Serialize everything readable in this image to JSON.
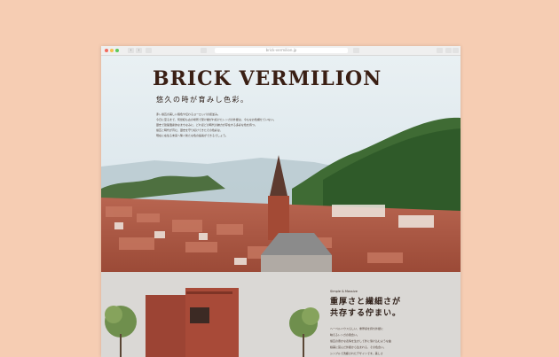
{
  "browser": {
    "url": "brick-vermilion.jp",
    "back_icon": "‹",
    "forward_icon": "›"
  },
  "hero": {
    "title": "BRICK VERMILION",
    "subtitle": "悠久の時が育みし色彩。",
    "body": [
      "赤レ煉瓦の美しい曇色や伝わるヨーロッパの街並み。",
      "今日に至るまで、何世紀も古の場所で受け継がれ続けたレンガの外壁は、今もなお色褪せていない。",
      "歴史で建築遺産的なまちなみに、どれほどの時代の魅力が存在する多彩な色を持つ。",
      "煉瓦と時代が育む、歴史を守り続けてきたその色彩は、",
      "現在に在住る未来へ繋ぐ新たな色の提案ができるでしょう。"
    ]
  },
  "section2": {
    "small_label": "Simple & Massive",
    "heading_lines": [
      "重厚さと繊細さが",
      "共存する佇まい。"
    ],
    "body": [
      "ヘーベルハウスらしい、重厚感を持ち外壁に",
      "映えるレンガの風合い。",
      "煉瓦の豊かな表情を生かして外に溶け込むような曲",
      "線美に富んだ外観から生まれる、その色合い。",
      "シンプルで洗練されたデザインです。美しさ"
    ]
  },
  "colors": {
    "page_bg": "#f6cdb3",
    "title": "#3a1f14",
    "brick": "#9c4434",
    "lower_bg": "#dad8d5"
  }
}
